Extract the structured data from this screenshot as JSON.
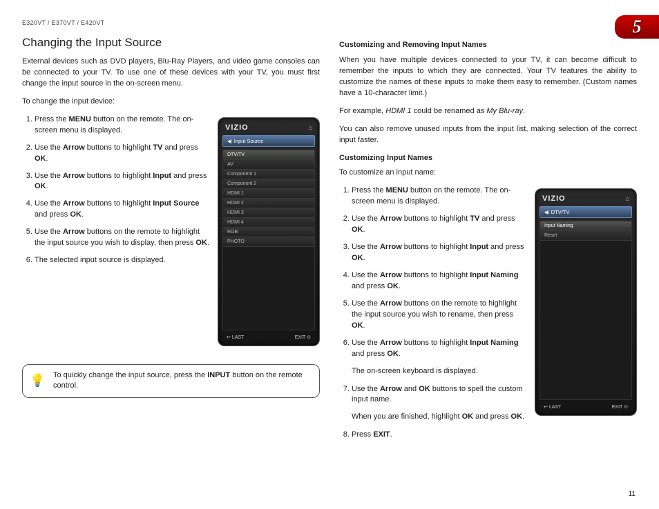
{
  "header": {
    "models": "E320VT / E370VT / E420VT"
  },
  "chapter": "5",
  "page_number": "11",
  "left": {
    "title": "Changing the Input Source",
    "intro": "External devices such as DVD players, Blu-Ray Players, and video game consoles can be connected to your TV. To use one of these devices with your TV, you must first change the input source in the on-screen menu.",
    "lead": "To change the input device:",
    "steps": [
      {
        "pre": "Press the ",
        "b": "MENU",
        "post": " button on the remote. The on-screen menu is displayed."
      },
      {
        "pre": "Use the ",
        "b": "Arrow",
        "mid": " buttons to highlight ",
        "b2": "TV",
        "post": " and press ",
        "b3": "OK",
        "end": "."
      },
      {
        "pre": "Use the ",
        "b": "Arrow",
        "mid": " buttons to highlight ",
        "b2": "Input",
        "post": " and press ",
        "b3": "OK",
        "end": "."
      },
      {
        "pre": "Use the ",
        "b": "Arrow",
        "mid": " buttons to highlight ",
        "b2": "Input Source",
        "post": " and press ",
        "b3": "OK",
        "end": "."
      },
      {
        "pre": "Use the ",
        "b": "Arrow",
        "post": " buttons on the remote to highlight the input source you wish to display, then press ",
        "b3": "OK",
        "end": "."
      },
      {
        "pre": "The selected input source is displayed."
      }
    ],
    "phone": {
      "brand": "VIZIO",
      "title": "Input Source",
      "rows": [
        "DTV/TV",
        "AV",
        "Component 1",
        "Component 2",
        "HDMI 1",
        "HDMI 2",
        "HDMI 3",
        "HDMI 4",
        "RGB",
        "PHOTO"
      ],
      "last": "LAST",
      "exit": "EXIT"
    },
    "tip": {
      "pre": "To quickly change the input source, press the ",
      "b": "INPUT",
      "post": " button on the remote control."
    }
  },
  "right": {
    "head1": "Customizing and Removing Input Names",
    "p1": "When you have multiple devices connected to your TV, it can become difficult to remember the inputs to which they are connected. Your TV features the ability to customize the names of these inputs to make them easy to remember. (Custom names have a 10-character limit.)",
    "p2a": "For example, ",
    "p2i1": "HDMI 1",
    "p2b": " could be renamed as ",
    "p2i2": "My Blu-ray",
    "p2c": ".",
    "p3": "You can also remove unused inputs from the input list, making selection of the correct input faster.",
    "head2": "Customizing Input Names",
    "lead": "To customize an input name:",
    "steps": [
      {
        "pre": "Press the ",
        "b": "MENU",
        "post": " button on the remote. The on-screen menu is displayed."
      },
      {
        "pre": "Use the ",
        "b": "Arrow",
        "mid": " buttons to highlight ",
        "b2": "TV",
        "post": " and press ",
        "b3": "OK",
        "end": "."
      },
      {
        "pre": "Use the ",
        "b": "Arrow",
        "mid": " buttons to highlight ",
        "b2": "Input",
        "post": " and press ",
        "b3": "OK",
        "end": "."
      },
      {
        "pre": "Use the ",
        "b": "Arrow",
        "mid": " buttons to highlight ",
        "b2": "Input Naming",
        "post": " and press ",
        "b3": "OK",
        "end": "."
      },
      {
        "pre": "Use the ",
        "b": "Arrow",
        "post": " buttons on the remote to highlight the input source you wish to rename, then press ",
        "b3": "OK",
        "end": "."
      },
      {
        "pre": "Use the ",
        "b": "Arrow",
        "mid": " buttons to highlight ",
        "b2": "Input Naming",
        "post": " and press ",
        "b3": "OK",
        "end": ".",
        "trail": "The on-screen keyboard is displayed."
      },
      {
        "pre": "Use the ",
        "b": "Arrow",
        "mid": " and ",
        "b2": "OK",
        "post": " buttons to spell the custom input name.",
        "trail2a": "When you are finished, highlight ",
        "trail2b": "OK",
        "trail2c": " and press ",
        "trail2d": "OK",
        "trail2e": "."
      },
      {
        "pre": "Press ",
        "b": "EXIT",
        "end": "."
      }
    ],
    "phone": {
      "brand": "VIZIO",
      "title": "DTV/TV",
      "rows": [
        "Input Naming",
        "Reset"
      ],
      "last": "LAST",
      "exit": "EXIT"
    }
  }
}
